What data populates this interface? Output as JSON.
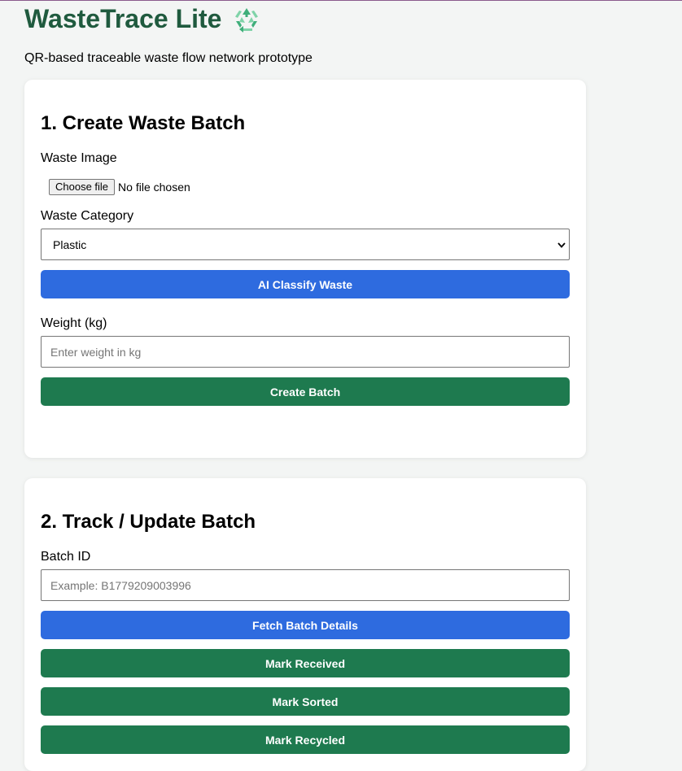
{
  "app": {
    "title": "WasteTrace Lite",
    "subtitle": "QR-based traceable waste flow network prototype",
    "icon": "recycle-icon"
  },
  "colors": {
    "title": "#1f5a3e",
    "primary_blue": "#2e6bdf",
    "primary_green": "#1e7a4f",
    "background": "#f3f5f4"
  },
  "create_batch": {
    "heading": "1. Create Waste Batch",
    "image_label": "Waste Image",
    "file_button": "Choose file",
    "file_status": "No file chosen",
    "category_label": "Waste Category",
    "category_selected": "Plastic",
    "classify_button": "AI Classify Waste",
    "weight_label": "Weight (kg)",
    "weight_value": "",
    "weight_placeholder": "Enter weight in kg",
    "create_button": "Create Batch"
  },
  "track_batch": {
    "heading": "2. Track / Update Batch",
    "batch_id_label": "Batch ID",
    "batch_id_value": "",
    "batch_id_placeholder": "Example: B1779209003996",
    "fetch_button": "Fetch Batch Details",
    "received_button": "Mark Received",
    "sorted_button": "Mark Sorted",
    "recycled_button": "Mark Recycled"
  }
}
